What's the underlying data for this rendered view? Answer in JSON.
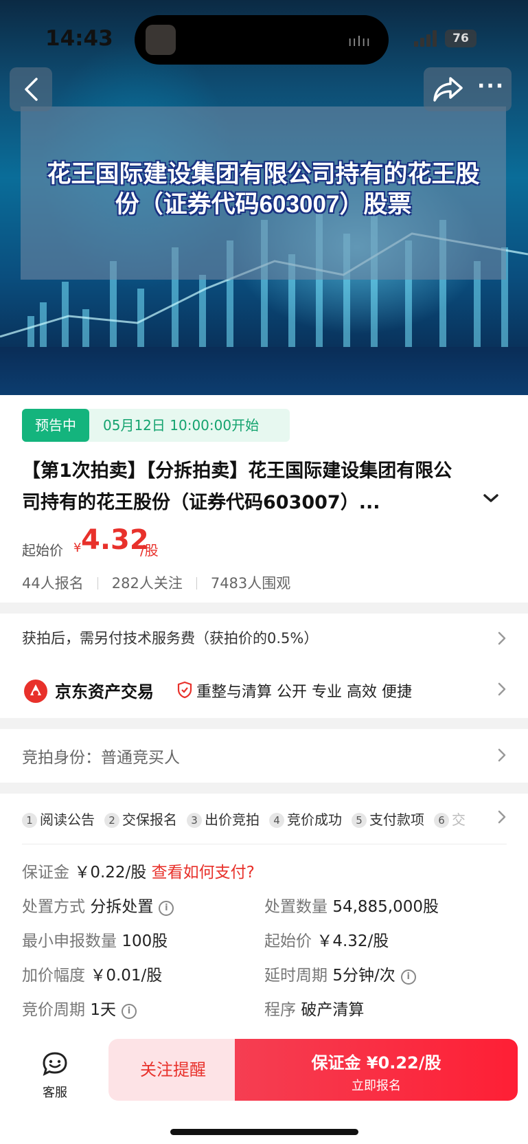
{
  "status_bar": {
    "time": "14:43",
    "battery": "76"
  },
  "hero": {
    "title_line1": "花王国际建设集团有限公司持有的花王股",
    "title_line2": "份（证券代码603007）股票"
  },
  "auction": {
    "badge": "预告中",
    "start_time": "05月12日 10:00:00开始",
    "title_line1": "【第1次拍卖】【分拆拍卖】花王国际建设集团有限公",
    "title_line2": "司持有的花王股份（证券代码603007）...",
    "price_label": "起始价",
    "currency": "¥",
    "price": "4.32",
    "price_unit": "/股",
    "signups": "44人报名",
    "followers": "282人关注",
    "viewers": "7483人围观"
  },
  "service": {
    "fee_note": "获拍后，需另付技术服务费（获拍价的0.5%）",
    "platform_name": "京东资产交易",
    "platform_tags": "重整与清算  公开 专业 高效 便捷"
  },
  "identity": {
    "text": "竞拍身份：普通竞买人"
  },
  "steps": [
    {
      "num": "1",
      "label": "阅读公告"
    },
    {
      "num": "2",
      "label": "交保报名"
    },
    {
      "num": "3",
      "label": "出价竞拍"
    },
    {
      "num": "4",
      "label": "竞价成功"
    },
    {
      "num": "5",
      "label": "支付款项"
    },
    {
      "num": "6",
      "label": "交"
    }
  ],
  "details": {
    "deposit_label": "保证金",
    "deposit_value": "￥0.22/股",
    "deposit_link": "查看如何支付?",
    "method_label": "处置方式",
    "method_value": "分拆处置",
    "quantity_label": "处置数量",
    "quantity_value": "54,885,000股",
    "min_label": "最小申报数量",
    "min_value": "100股",
    "start_label": "起始价",
    "start_value": "￥4.32/股",
    "increment_label": "加价幅度",
    "increment_value": "￥0.01/股",
    "delay_label": "延时周期",
    "delay_value": "5分钟/次",
    "cycle_label": "竞价周期",
    "cycle_value": "1天",
    "procedure_label": "程序",
    "procedure_value": "破产清算"
  },
  "bottom_bar": {
    "service_label": "客服",
    "follow_label": "关注提醒",
    "signup_main": "保证金 ¥0.22/股",
    "signup_sub": "立即报名"
  },
  "colors": {
    "accent_red": "#e8312b",
    "status_green": "#14b47d"
  }
}
